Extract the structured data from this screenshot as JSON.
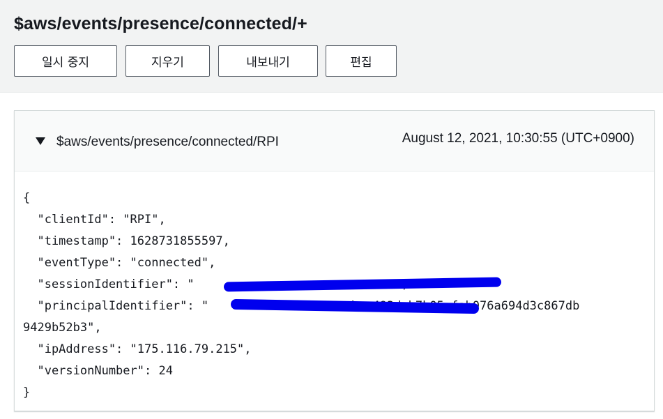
{
  "header": {
    "title": "$aws/events/presence/connected/+",
    "buttons": {
      "pause": "일시 중지",
      "clear": "지우기",
      "export": "내보내기",
      "edit": "편집"
    }
  },
  "message": {
    "topic": "$aws/events/presence/connected/RPI",
    "timestamp": "August 12, 2021, 10:30:55 (UTC+0900)",
    "payload_lines": [
      "{",
      "  \"clientId\": \"RPI\",",
      "  \"timestamp\": 1628731855597,",
      "  \"eventType\": \"connected\",",
      "  \"sessionIdentifier\": \"                            \",",
      "  \"principalIdentifier\": \"                    bac493deb7b05efab076a694d3c867db",
      "9429b52b3\",",
      "  \"ipAddress\": \"175.116.79.215\",",
      "  \"versionNumber\": 24",
      "}"
    ]
  },
  "colors": {
    "header_bg": "#f2f3f3",
    "border": "#545b64",
    "redaction": "#0000ee"
  }
}
